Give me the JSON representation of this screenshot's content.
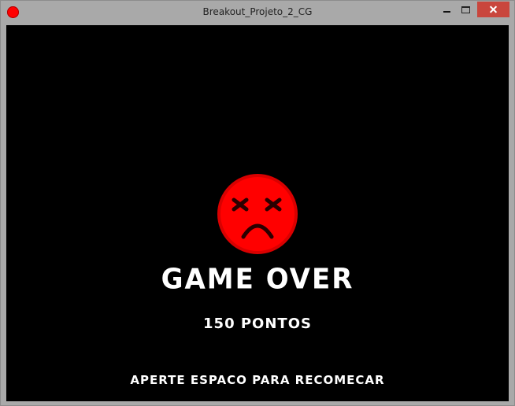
{
  "window": {
    "title": "Breakout_Projeto_2_CG",
    "controls": [
      "minimize",
      "maximize",
      "close"
    ]
  },
  "game": {
    "status_icon": "sad-face-icon",
    "status_icon_color": "#ff0000",
    "headline": "GAME OVER",
    "score_text": "150 PONTOS",
    "prompt": "APERTE ESPACO PARA RECOMECAR"
  },
  "colors": {
    "canvas": "#000000",
    "text": "#ffffff",
    "close_button": "#c9463d",
    "frame": "#a9a9a9"
  }
}
